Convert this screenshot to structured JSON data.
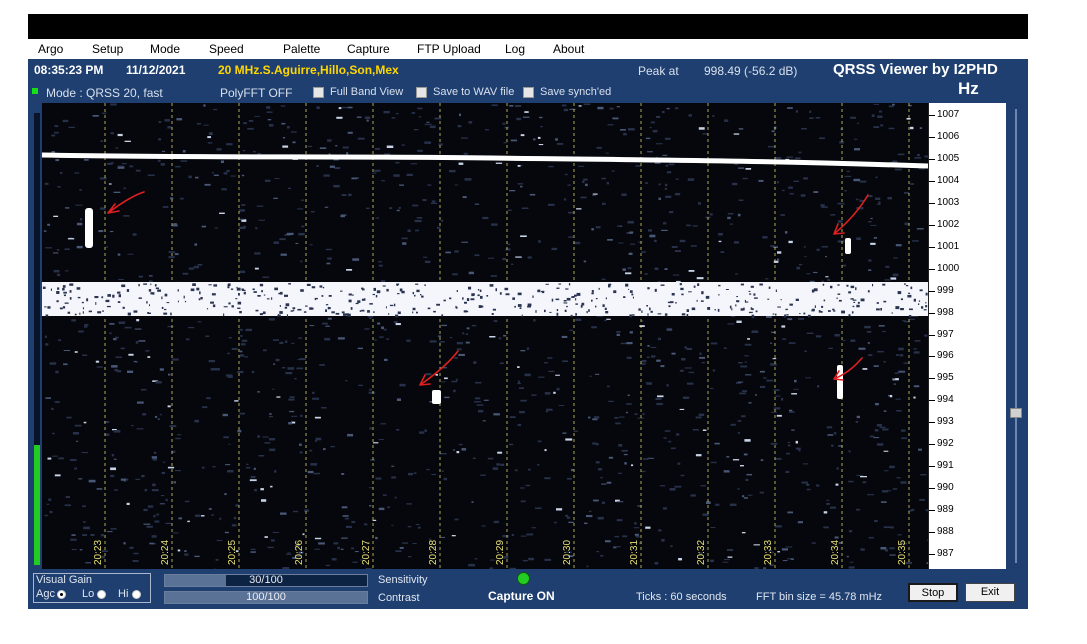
{
  "menu": {
    "items": [
      "Argo",
      "Setup",
      "Mode",
      "Speed",
      "Palette",
      "Capture",
      "FTP Upload",
      "Log",
      "About"
    ]
  },
  "status": {
    "time": "08:35:23 PM",
    "date": "11/12/2021",
    "station": "20 MHz.S.Aguirre,Hillo,Son,Mex",
    "peak_label": "Peak at",
    "peak_value": "998.49 (-56.2 dB)",
    "app_title": "QRSS Viewer by I2PHD",
    "unit": "Hz"
  },
  "options": {
    "mode": "Mode : QRSS 20, fast",
    "polyfft": "PolyFFT OFF",
    "checkboxes": [
      "Full Band View",
      "Save to WAV file",
      "Save synch'ed"
    ]
  },
  "waterfall": {
    "freq_axis_hz": [
      "1007",
      "1006",
      "1005",
      "1004",
      "1003",
      "1002",
      "1001",
      "1000",
      "999",
      "998",
      "997",
      "996",
      "995",
      "994",
      "993",
      "992",
      "991",
      "990",
      "989",
      "988",
      "987"
    ],
    "time_labels": [
      "20:23",
      "20:24",
      "20:25",
      "20:26",
      "20:27",
      "20:28",
      "20:29",
      "20:30",
      "20:31",
      "20:32",
      "20:33",
      "20:34",
      "20:35"
    ]
  },
  "controls": {
    "visual_gain_title": "Visual Gain",
    "agc_label": "Agc",
    "lo_label": "Lo",
    "hi_label": "Hi",
    "sensitivity_value": "30/100",
    "sensitivity_level": 0.3,
    "sensitivity_label": "Sensitivity",
    "contrast_value": "100/100",
    "contrast_level": 1.0,
    "contrast_label": "Contrast",
    "capture_status": "Capture ON",
    "ticks": "Ticks   : 60 seconds",
    "fft_bin": "FFT bin size = 45.78 mHz",
    "stop_button": "Stop",
    "exit_button": "Exit"
  },
  "colors": {
    "panel_bg": "#1e3f6f",
    "station_text": "#ffd700",
    "time_label": "#e8e070",
    "capture_led": "#22cc22",
    "annotation_arrows": "#e02020"
  }
}
